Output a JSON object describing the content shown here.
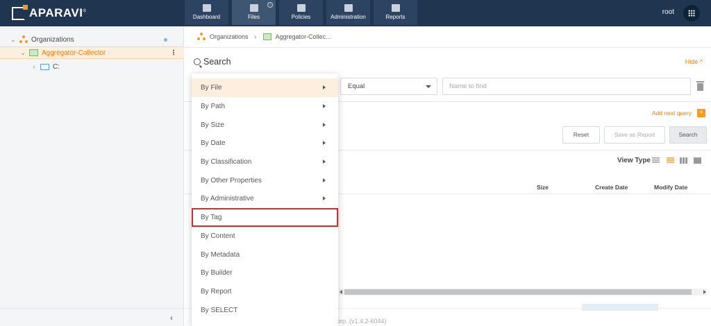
{
  "app": {
    "logo_text": "APARAVI",
    "logo_mark": "®"
  },
  "nav": {
    "items": [
      {
        "label": "Dashboard",
        "icon": "dashboard-icon"
      },
      {
        "label": "Files",
        "icon": "folder-icon"
      },
      {
        "label": "Policies",
        "icon": "gear-icon"
      },
      {
        "label": "Administration",
        "icon": "users-icon"
      },
      {
        "label": "Reports",
        "icon": "clipboard-icon"
      }
    ],
    "active": "Files"
  },
  "header": {
    "user": "root"
  },
  "tree": {
    "organizations": "Organizations",
    "collector": "Aggregator-Collector",
    "drive": "C:"
  },
  "breadcrumb": {
    "items": [
      "Organizations",
      "Aggregator-Collec..."
    ]
  },
  "search": {
    "title": "Search",
    "hide": "Hide",
    "operator": "Equal",
    "name_placeholder": "Name to find",
    "add_next": "Add next query",
    "add_plus": "+"
  },
  "buttons": {
    "reset": "Reset",
    "save_report": "Save as Report",
    "search": "Search"
  },
  "results": {
    "view_type": "View Type",
    "columns": [
      "Size",
      "Create Date",
      "Modify Date"
    ]
  },
  "footer": {
    "version_text": "orp. (v1.4.2-6044)"
  },
  "dropdown": {
    "items": [
      {
        "label": "By File",
        "has_submenu": true
      },
      {
        "label": "By Path",
        "has_submenu": true
      },
      {
        "label": "By Size",
        "has_submenu": true
      },
      {
        "label": "By Date",
        "has_submenu": true
      },
      {
        "label": "By Classification",
        "has_submenu": true
      },
      {
        "label": "By Other Properties",
        "has_submenu": true
      },
      {
        "label": "By Administrative",
        "has_submenu": true
      },
      {
        "label": "By Tag",
        "has_submenu": false
      },
      {
        "label": "By Content",
        "has_submenu": false
      },
      {
        "label": "By Metadata",
        "has_submenu": false
      },
      {
        "label": "By Builder",
        "has_submenu": false
      },
      {
        "label": "By Report",
        "has_submenu": false
      },
      {
        "label": "By SELECT",
        "has_submenu": false
      }
    ],
    "hovered": "By File",
    "highlighted": "By Tag"
  },
  "colors": {
    "topbar": "#1f3550",
    "accent": "#f07d00",
    "highlight_border": "#d42b2b"
  }
}
